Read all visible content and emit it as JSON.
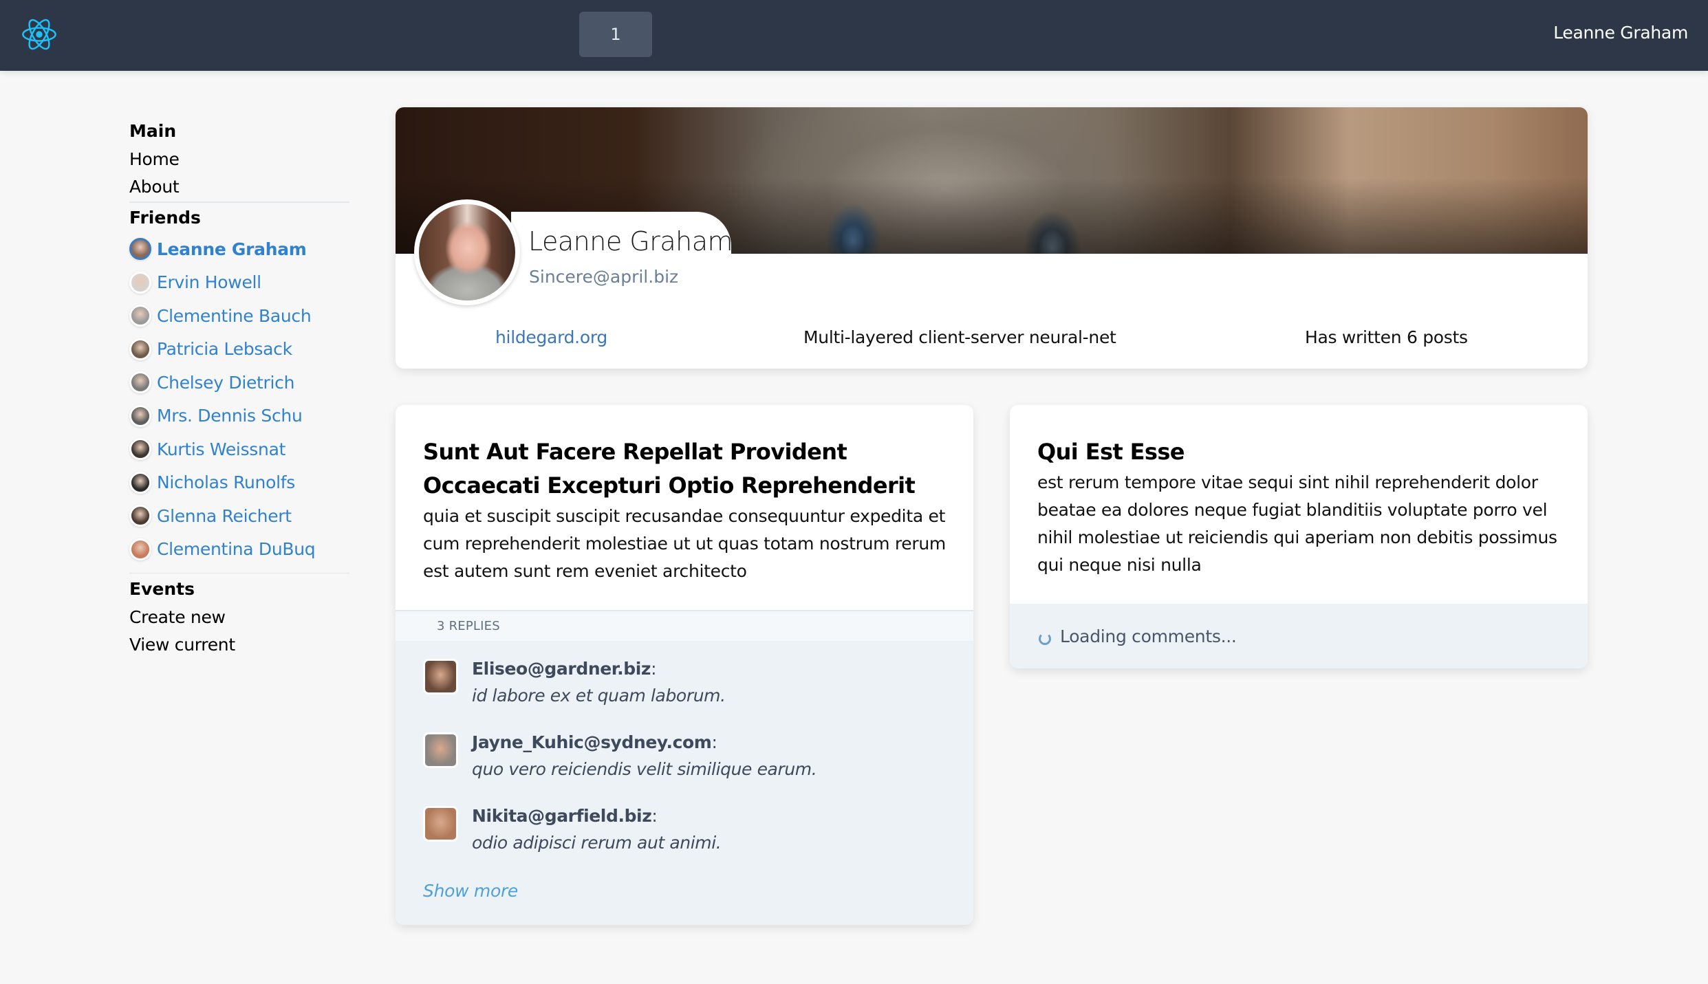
{
  "header": {
    "logo_icon": "react-atom-icon",
    "page_button_label": "1",
    "current_user": "Leanne Graham",
    "colors": {
      "bg": "#2d3748",
      "button_bg": "#4a5568",
      "logo": "#1ec0f5"
    }
  },
  "sidebar": {
    "main": {
      "heading": "Main",
      "items": [
        {
          "label": "Home"
        },
        {
          "label": "About"
        }
      ]
    },
    "friends": {
      "heading": "Friends",
      "items": [
        {
          "name": "Leanne Graham",
          "active": true,
          "avatar_color": "#8a6a58"
        },
        {
          "name": "Ervin Howell",
          "active": false,
          "avatar_color": "#d8d2ce"
        },
        {
          "name": "Clementine Bauch",
          "active": false,
          "avatar_color": "#9a9a9a"
        },
        {
          "name": "Patricia Lebsack",
          "active": false,
          "avatar_color": "#6d5a4a"
        },
        {
          "name": "Chelsey Dietrich",
          "active": false,
          "avatar_color": "#7a7a7a"
        },
        {
          "name": "Mrs. Dennis Schu",
          "active": false,
          "avatar_color": "#5e5e5e"
        },
        {
          "name": "Kurtis Weissnat",
          "active": false,
          "avatar_color": "#3c3530"
        },
        {
          "name": "Nicholas Runolfs",
          "active": false,
          "avatar_color": "#2a2a2a"
        },
        {
          "name": "Glenna Reichert",
          "active": false,
          "avatar_color": "#4a3a30"
        },
        {
          "name": "Clementina DuBuq",
          "active": false,
          "avatar_color": "#c87a5a"
        }
      ]
    },
    "events": {
      "heading": "Events",
      "items": [
        {
          "label": "Create new"
        },
        {
          "label": "View current"
        }
      ]
    },
    "link_color": "#3182ce"
  },
  "profile": {
    "name": "Leanne Graham",
    "email": "Sincere@april.biz",
    "website": "hildegard.org",
    "catch_phrase": "Multi-layered client-server neural-net",
    "posts_summary": "Has written 6 posts"
  },
  "posts": [
    {
      "title": "Sunt Aut Facere Repellat Provident Occaecati Excepturi Optio Reprehenderit",
      "body": "quia et suscipit suscipit recusandae consequuntur expedita et cum reprehenderit molestiae ut ut quas totam nostrum rerum est autem sunt rem eveniet architecto",
      "replies_label": "3 REPLIES",
      "comments": [
        {
          "email": "Eliseo@gardner.biz",
          "text": "id labore ex et quam laborum.",
          "avatar_color": "#6a4a3a"
        },
        {
          "email": "Jayne_Kuhic@sydney.com",
          "text": "quo vero reiciendis velit similique earum.",
          "avatar_color": "#8a8580"
        },
        {
          "email": "Nikita@garfield.biz",
          "text": "odio adipisci rerum aut animi.",
          "avatar_color": "#b07a5a"
        }
      ],
      "show_more_label": "Show more"
    },
    {
      "title": "Qui Est Esse",
      "body": "est rerum tempore vitae sequi sint nihil reprehenderit dolor beatae ea dolores neque fugiat blanditiis voluptate porro vel nihil molestiae ut reiciendis qui aperiam non debitis possimus qui neque nisi nulla",
      "loading_label": "Loading comments..."
    }
  ]
}
